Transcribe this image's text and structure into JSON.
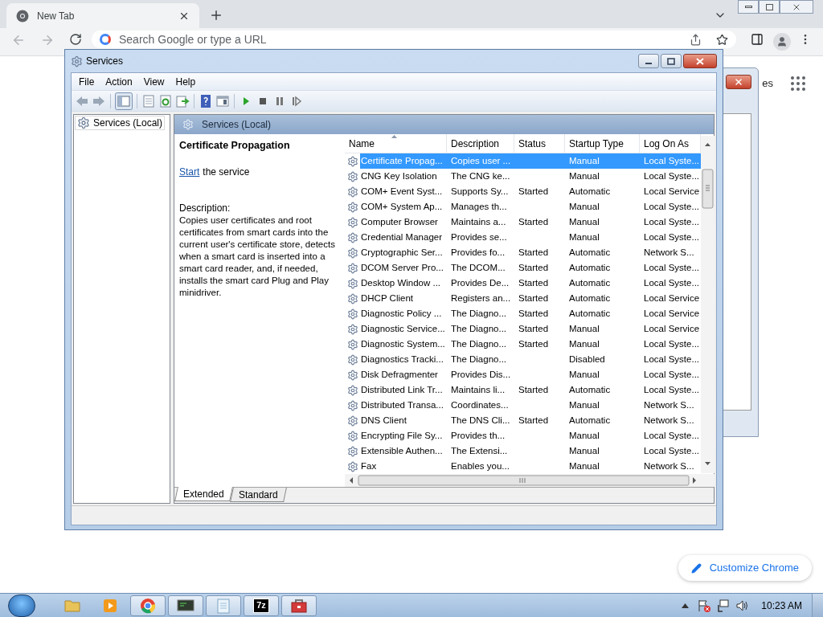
{
  "browser": {
    "tab_title": "New Tab",
    "address_placeholder": "Search Google or type a URL",
    "partial_link": "es",
    "customize_label": "Customize Chrome"
  },
  "services": {
    "title": "Services",
    "menu": [
      "File",
      "Action",
      "View",
      "Help"
    ],
    "tree_item": "Services (Local)",
    "header_title": "Services (Local)",
    "detail": {
      "name": "Certificate Propagation",
      "action_link": "Start",
      "action_rest": "the service",
      "description_label": "Description:",
      "description": "Copies user certificates and root certificates from smart cards into the current user's certificate store, detects when a smart card is inserted into a smart card reader, and, if needed, installs the smart card Plug and Play minidriver."
    },
    "columns": [
      {
        "label": "Name",
        "sorted": true
      },
      {
        "label": "Description",
        "sorted": false
      },
      {
        "label": "Status",
        "sorted": false
      },
      {
        "label": "Startup Type",
        "sorted": false
      },
      {
        "label": "Log On As",
        "sorted": false
      }
    ],
    "rows": [
      {
        "name": "Certificate Propag...",
        "description": "Copies user ...",
        "status": "",
        "startup_type": "Manual",
        "log_on_as": "Local Syste...",
        "selected": true
      },
      {
        "name": "CNG Key Isolation",
        "description": "The CNG ke...",
        "status": "",
        "startup_type": "Manual",
        "log_on_as": "Local Syste...",
        "selected": false
      },
      {
        "name": "COM+ Event Syst...",
        "description": "Supports Sy...",
        "status": "Started",
        "startup_type": "Automatic",
        "log_on_as": "Local Service",
        "selected": false
      },
      {
        "name": "COM+ System Ap...",
        "description": "Manages th...",
        "status": "",
        "startup_type": "Manual",
        "log_on_as": "Local Syste...",
        "selected": false
      },
      {
        "name": "Computer Browser",
        "description": "Maintains a...",
        "status": "Started",
        "startup_type": "Manual",
        "log_on_as": "Local Syste...",
        "selected": false
      },
      {
        "name": "Credential Manager",
        "description": "Provides se...",
        "status": "",
        "startup_type": "Manual",
        "log_on_as": "Local Syste...",
        "selected": false
      },
      {
        "name": "Cryptographic Ser...",
        "description": "Provides fo...",
        "status": "Started",
        "startup_type": "Automatic",
        "log_on_as": "Network S...",
        "selected": false
      },
      {
        "name": "DCOM Server Pro...",
        "description": "The DCOM...",
        "status": "Started",
        "startup_type": "Automatic",
        "log_on_as": "Local Syste...",
        "selected": false
      },
      {
        "name": "Desktop Window ...",
        "description": "Provides De...",
        "status": "Started",
        "startup_type": "Automatic",
        "log_on_as": "Local Syste...",
        "selected": false
      },
      {
        "name": "DHCP Client",
        "description": "Registers an...",
        "status": "Started",
        "startup_type": "Automatic",
        "log_on_as": "Local Service",
        "selected": false
      },
      {
        "name": "Diagnostic Policy ...",
        "description": "The Diagno...",
        "status": "Started",
        "startup_type": "Automatic",
        "log_on_as": "Local Service",
        "selected": false
      },
      {
        "name": "Diagnostic Service...",
        "description": "The Diagno...",
        "status": "Started",
        "startup_type": "Manual",
        "log_on_as": "Local Service",
        "selected": false
      },
      {
        "name": "Diagnostic System...",
        "description": "The Diagno...",
        "status": "Started",
        "startup_type": "Manual",
        "log_on_as": "Local Syste...",
        "selected": false
      },
      {
        "name": "Diagnostics Tracki...",
        "description": "The Diagno...",
        "status": "",
        "startup_type": "Disabled",
        "log_on_as": "Local Syste...",
        "selected": false
      },
      {
        "name": "Disk Defragmenter",
        "description": "Provides Dis...",
        "status": "",
        "startup_type": "Manual",
        "log_on_as": "Local Syste...",
        "selected": false
      },
      {
        "name": "Distributed Link Tr...",
        "description": "Maintains li...",
        "status": "Started",
        "startup_type": "Automatic",
        "log_on_as": "Local Syste...",
        "selected": false
      },
      {
        "name": "Distributed Transa...",
        "description": "Coordinates...",
        "status": "",
        "startup_type": "Manual",
        "log_on_as": "Network S...",
        "selected": false
      },
      {
        "name": "DNS Client",
        "description": "The DNS Cli...",
        "status": "Started",
        "startup_type": "Automatic",
        "log_on_as": "Network S...",
        "selected": false
      },
      {
        "name": "Encrypting File Sy...",
        "description": "Provides th...",
        "status": "",
        "startup_type": "Manual",
        "log_on_as": "Local Syste...",
        "selected": false
      },
      {
        "name": "Extensible Authen...",
        "description": "The Extensi...",
        "status": "",
        "startup_type": "Manual",
        "log_on_as": "Local Syste...",
        "selected": false
      },
      {
        "name": "Fax",
        "description": "Enables you...",
        "status": "",
        "startup_type": "Manual",
        "log_on_as": "Network S...",
        "selected": false
      }
    ],
    "tabs": [
      {
        "label": "Extended",
        "selected": true
      },
      {
        "label": "Standard",
        "selected": false
      }
    ]
  },
  "taskbar": {
    "items": [
      {
        "kind": "folder",
        "running": false
      },
      {
        "kind": "media",
        "running": false
      },
      {
        "kind": "chrome",
        "running": true
      },
      {
        "kind": "terminal",
        "running": true
      },
      {
        "kind": "notepad",
        "running": true
      },
      {
        "kind": "archiver",
        "label": "7z",
        "running": true
      },
      {
        "kind": "toolbox",
        "running": true
      }
    ],
    "clock": "10:23 AM"
  }
}
